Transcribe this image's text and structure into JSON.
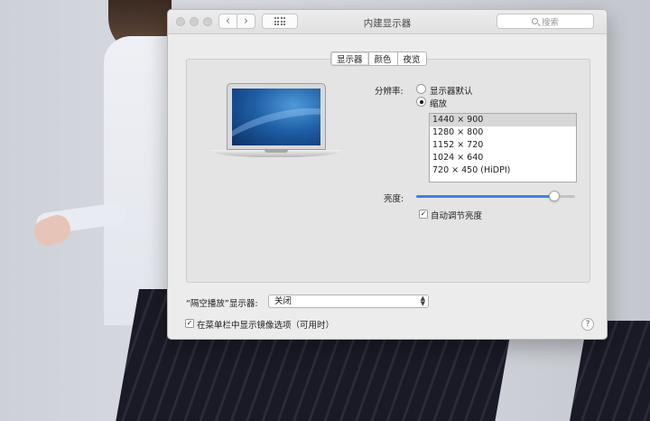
{
  "window": {
    "title": "内建显示器",
    "search_placeholder": "搜索"
  },
  "toolbar": {
    "back_glyph": "‹",
    "forward_glyph": "›"
  },
  "tabs": [
    {
      "label": "显示器",
      "active": true
    },
    {
      "label": "颜色",
      "active": false
    },
    {
      "label": "夜览",
      "active": false
    }
  ],
  "display": {
    "resolution_label": "分辨率:",
    "option_default": "显示器默认",
    "option_scaled": "缩放",
    "selected_option": "scaled",
    "resolutions": [
      "1440 × 900",
      "1280 × 800",
      "1152 × 720",
      "1024 × 640",
      "720 × 450 (HiDPI)"
    ],
    "selected_resolution_index": 0,
    "brightness_label": "亮度:",
    "brightness_level": 0.87,
    "auto_brightness_label": "自动调节亮度",
    "auto_brightness_checked": true
  },
  "airplay": {
    "label": "“隔空播放”显示器:",
    "value": "关闭"
  },
  "mirroring": {
    "label": "在菜单栏中显示镜像选项（可用时）",
    "checked": true
  },
  "help": {
    "glyph": "?"
  },
  "icons": {
    "search": "search-icon",
    "grid": "show-all-grid-icon",
    "laptop": "macbook-air-icon",
    "help": "help-icon"
  },
  "colors": {
    "accent": "#3f82e3",
    "window_bg": "#ececec",
    "panel_bg": "#e4e4e4"
  }
}
